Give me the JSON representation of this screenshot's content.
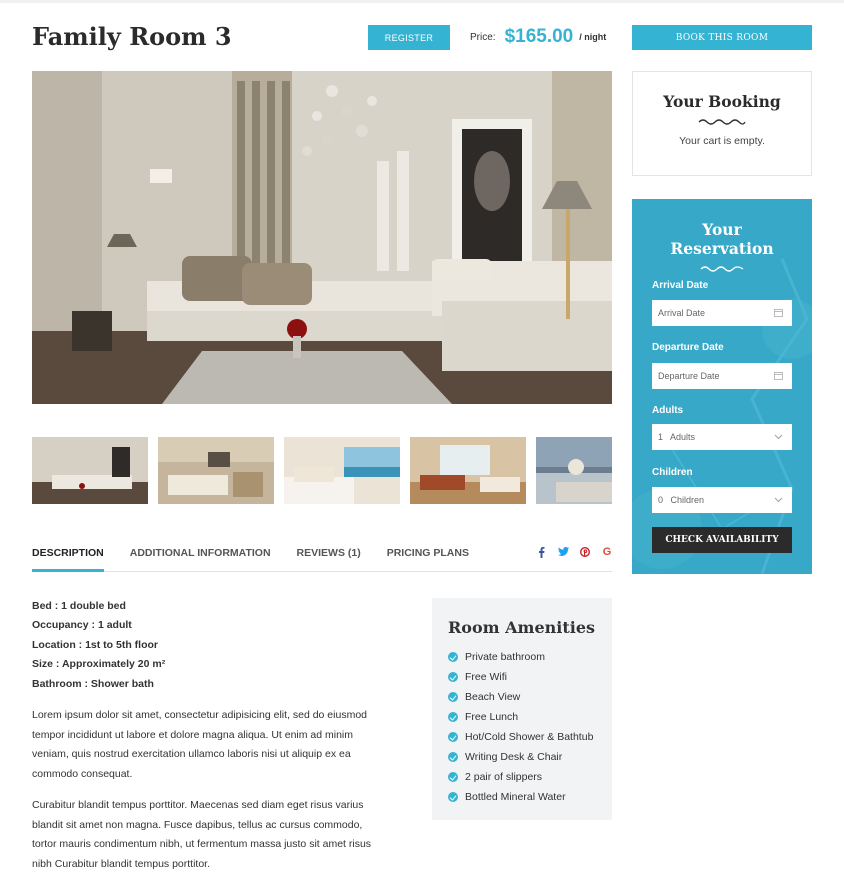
{
  "room": {
    "title": "Family Room 3",
    "register_label": "Register",
    "price_label": "Price:",
    "price_value": "$165.00",
    "price_unit": "/ night"
  },
  "sidebar": {
    "book_label": "Book This Room",
    "booking": {
      "title": "Your Booking",
      "empty_text": "Your cart is empty."
    },
    "reservation": {
      "title": "Your Reservation",
      "arrival_label": "Arrival Date",
      "arrival_placeholder": "Arrival Date",
      "departure_label": "Departure Date",
      "departure_placeholder": "Departure Date",
      "adults_label": "Adults",
      "adults_value": "1   Adults",
      "children_label": "Children",
      "children_value": "0   Children",
      "check_label": "Check Availability"
    }
  },
  "tabs": [
    {
      "label": "Description",
      "active": true
    },
    {
      "label": "Additional Information",
      "active": false
    },
    {
      "label": "Reviews (1)",
      "active": false
    },
    {
      "label": "Pricing Plans",
      "active": false
    }
  ],
  "socials": [
    {
      "icon": "facebook-icon",
      "glyph": "f",
      "color": "#3b5998"
    },
    {
      "icon": "twitter-icon",
      "glyph": "t",
      "color": "#1da1f2"
    },
    {
      "icon": "pinterest-icon",
      "glyph": "p",
      "color": "#cb2027"
    },
    {
      "icon": "google-icon",
      "glyph": "G",
      "color": "#dd4b39"
    }
  ],
  "facts": [
    "Bed : 1 double bed",
    "Occupancy : 1 adult",
    "Location : 1st to 5th floor",
    "Size : Approximately 20 m²",
    "Bathroom : Shower bath"
  ],
  "paragraphs": [
    "Lorem ipsum dolor sit amet, consectetur adipisicing elit, sed do eiusmod tempor incididunt ut labore et dolore magna aliqua. Ut enim ad minim veniam, quis nostrud exercitation ullamco laboris nisi ut aliquip ex ea commodo consequat.",
    "Curabitur blandit tempus porttitor. Maecenas sed diam eget risus varius blandit sit amet non magna. Fusce dapibus, tellus ac cursus commodo, tortor mauris condimentum nibh, ut fermentum massa justo sit amet risus nibh Curabitur blandit tempus porttitor."
  ],
  "amenities": {
    "title": "Room Amenities",
    "items": [
      "Private bathroom",
      "Free Wifi",
      "Beach View",
      "Free Lunch",
      "Hot/Cold Shower & Bathtub",
      "Writing Desk & Chair",
      "2 pair of slippers",
      "Bottled Mineral Water"
    ]
  },
  "colors": {
    "accent": "#34b3d2",
    "reservation_bg": "#37a8c7",
    "dark_button": "#2b2b2b"
  }
}
